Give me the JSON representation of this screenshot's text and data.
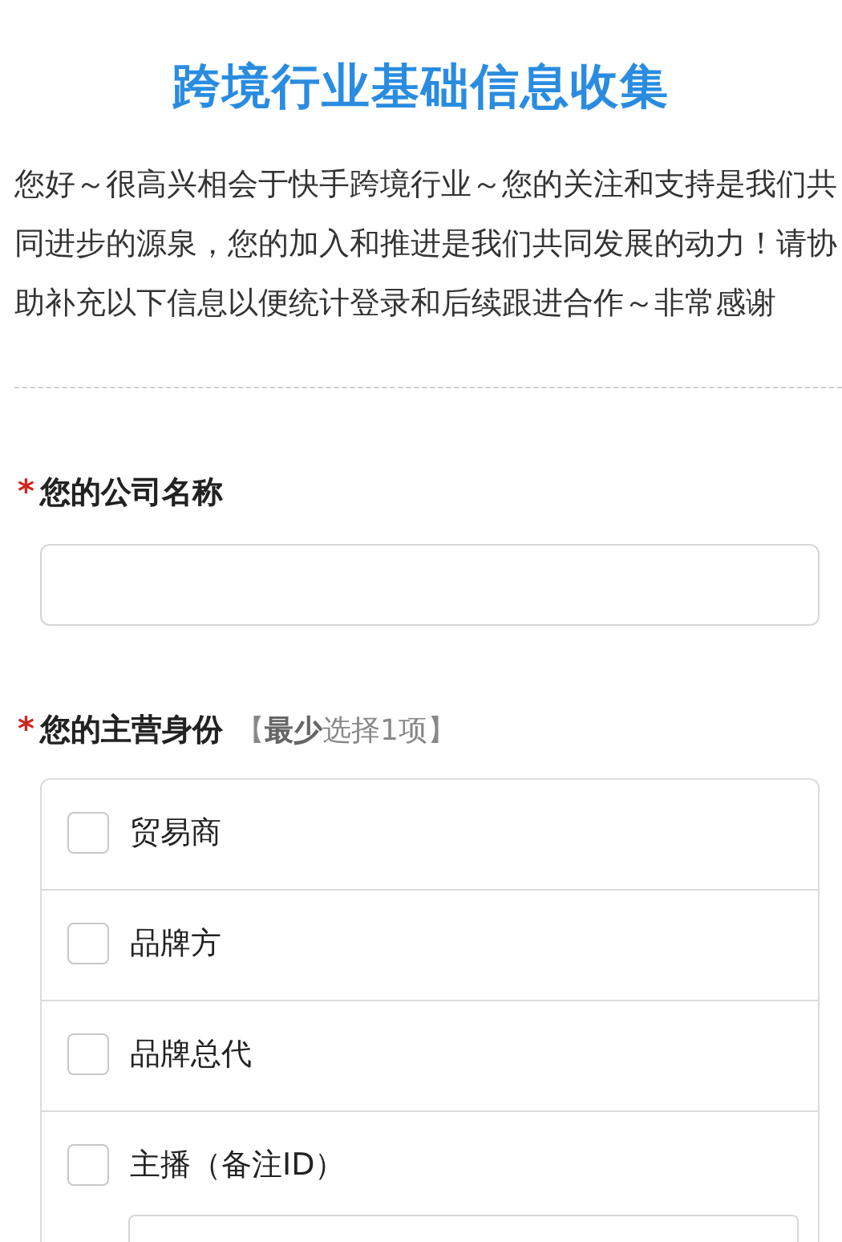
{
  "title": "跨境行业基础信息收集",
  "intro": "您好～很高兴相会于快手跨境行业～您的关注和支持是我们共同进步的源泉，您的加入和推进是我们共同发展的动力！请协助补充以下信息以便统计登录和后续跟进合作～非常感谢",
  "questions": [
    {
      "kind": "text",
      "required": true,
      "mark": "*",
      "label": "您的公司名称"
    },
    {
      "kind": "checkbox",
      "required": true,
      "mark": "*",
      "label": "您的主营身份",
      "hint": "【**最少**选择1项】",
      "options": [
        {
          "label": "贸易商",
          "checked": false,
          "note_field": false
        },
        {
          "label": "品牌方",
          "checked": false,
          "note_field": false
        },
        {
          "label": "品牌总代",
          "checked": false,
          "note_field": false
        },
        {
          "label": "主播（备注ID）",
          "checked": false,
          "note_field": true
        }
      ]
    }
  ]
}
